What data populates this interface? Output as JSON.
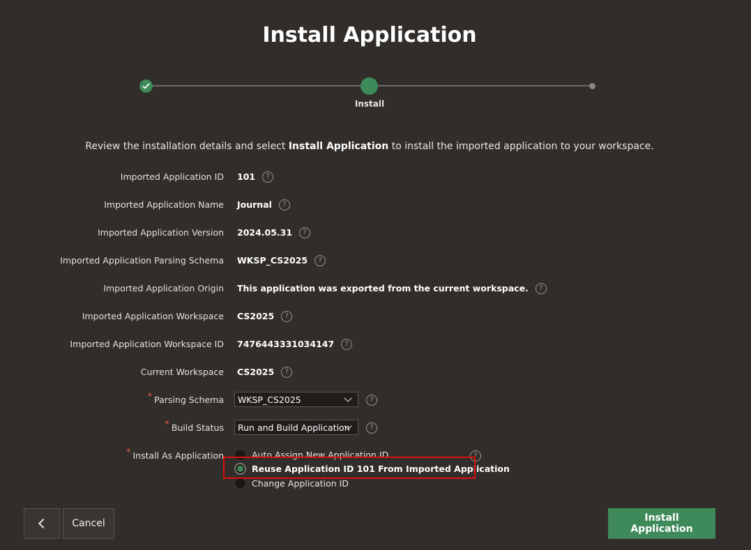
{
  "page": {
    "title": "Install Application",
    "intro_pre": "Review the installation details and select ",
    "intro_bold": "Install Application",
    "intro_post": " to install the imported application to your workspace."
  },
  "wizard": {
    "current_step_label": "Install",
    "steps_total": 3,
    "current_step": 2
  },
  "details": [
    {
      "label": "Imported Application ID",
      "value": "101"
    },
    {
      "label": "Imported Application Name",
      "value": "Journal"
    },
    {
      "label": "Imported Application Version",
      "value": "2024.05.31"
    },
    {
      "label": "Imported Application Parsing Schema",
      "value": "WKSP_CS2025"
    },
    {
      "label": "Imported Application Origin",
      "value": "This application was exported from the current workspace."
    },
    {
      "label": "Imported Application Workspace",
      "value": "CS2025"
    },
    {
      "label": "Imported Application Workspace ID",
      "value": "7476443331034147"
    },
    {
      "label": "Current Workspace",
      "value": "CS2025"
    }
  ],
  "parsing_schema": {
    "required_mark": "*",
    "label": "Parsing Schema",
    "value": "WKSP_CS2025"
  },
  "build_status": {
    "required_mark": "*",
    "label": "Build Status",
    "value": "Run and Build Application"
  },
  "install_as": {
    "required_mark": "*",
    "label": "Install As Application",
    "options": [
      {
        "label": "Auto Assign New Application ID",
        "checked": false
      },
      {
        "label": "Reuse Application ID 101 From Imported Application",
        "checked": true
      },
      {
        "label": "Change Application ID",
        "checked": false
      }
    ]
  },
  "help_glyph": "?",
  "buttons": {
    "cancel": "Cancel",
    "install": "Install Application"
  },
  "colors": {
    "background": "#312d2a",
    "accent": "#3f8a5a",
    "highlight": "#e01010"
  }
}
